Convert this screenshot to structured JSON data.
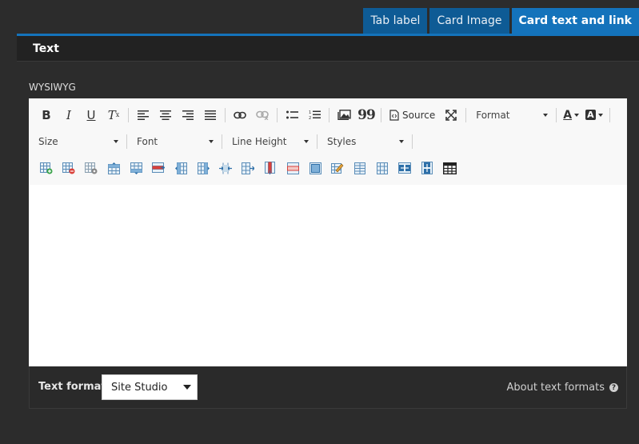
{
  "tabs": [
    {
      "label": "Tab label"
    },
    {
      "label": "Card Image"
    },
    {
      "label": "Card text and link"
    }
  ],
  "panel": {
    "title": "Text"
  },
  "field": {
    "label": "WYSIWYG"
  },
  "toolbar": {
    "source_label": "Source",
    "format_label": "Format",
    "size_label": "Size",
    "font_label": "Font",
    "line_height_label": "Line Height",
    "styles_label": "Styles",
    "bold_glyph": "B",
    "italic_glyph": "I",
    "underline_glyph": "U",
    "clear_glyph": "T",
    "clear_sub": "x",
    "quote_glyph": "99",
    "text_color_glyph": "A",
    "bg_color_glyph": "A"
  },
  "text_format": {
    "label": "Text format",
    "selected": "Site Studio",
    "about_label": "About text formats",
    "help_glyph": "?"
  },
  "colors": {
    "tab_active": "#1473bb",
    "tab_inactive": "#0e5b95",
    "background": "#2c2c2c",
    "header": "#222222"
  }
}
